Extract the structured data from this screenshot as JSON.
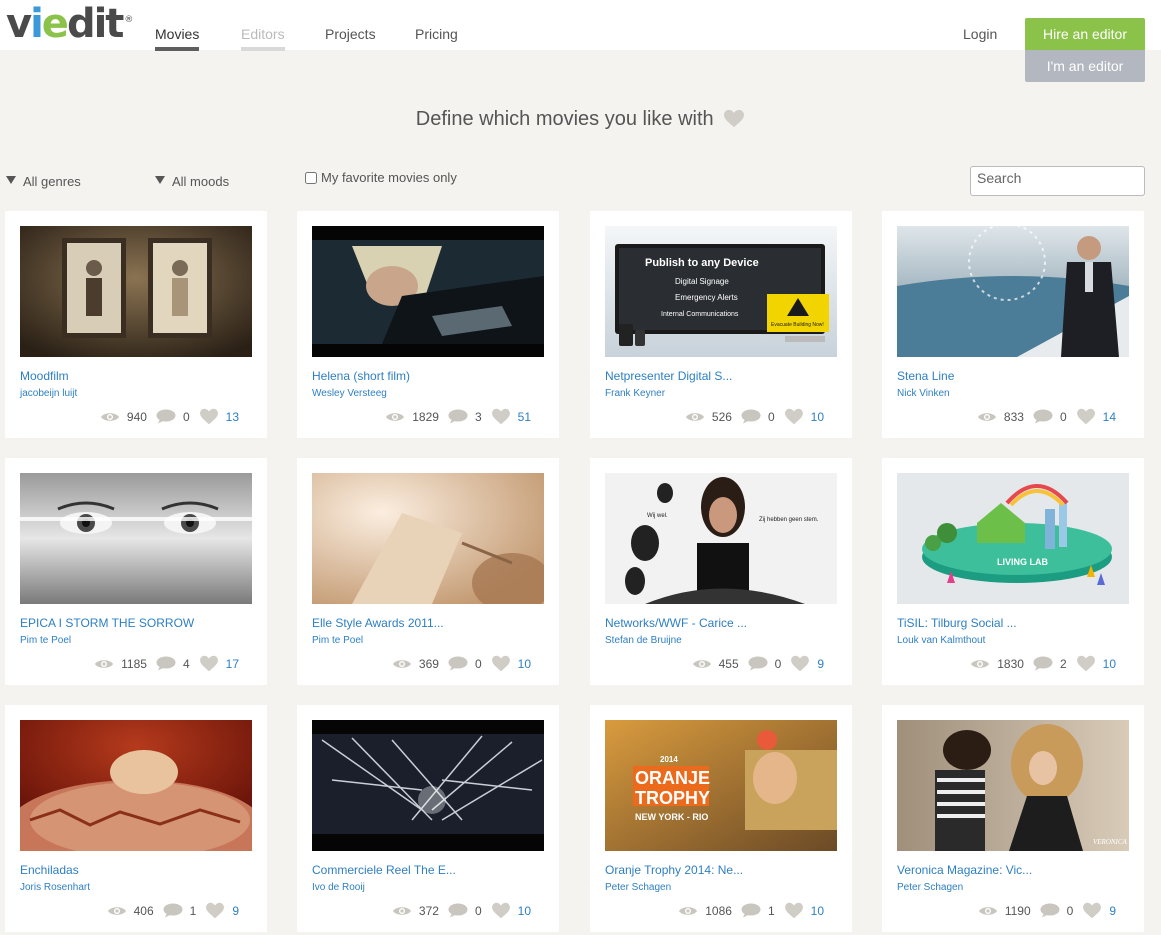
{
  "app": {
    "logo": {
      "v": "v",
      "i": "i",
      "e": "e",
      "dit": "dit",
      "reg": "®"
    }
  },
  "nav": {
    "items": [
      {
        "label": "Movies",
        "state": "active"
      },
      {
        "label": "Editors",
        "state": "muted"
      },
      {
        "label": "Projects",
        "state": "normal"
      },
      {
        "label": "Pricing",
        "state": "normal"
      }
    ],
    "login": "Login",
    "hire_button": "Hire an editor",
    "editor_button": "I'm an editor"
  },
  "colors": {
    "accent_green": "#8bc34a",
    "link_blue": "#2e7fc3",
    "muted_button": "#b3b7bf",
    "heart_grey": "#d0ccc6"
  },
  "headline": {
    "text": "Define which movies you like with",
    "icon": "heart-icon"
  },
  "filters": {
    "genres": "All genres",
    "moods": "All moods",
    "favorites_label": "My favorite movies only",
    "favorites_checked": false,
    "search_placeholder": "Search"
  },
  "movies": [
    {
      "title": "Moodfilm",
      "author": "jacobeijn luijt",
      "views": "940",
      "comments": "0",
      "likes": "13"
    },
    {
      "title": "Helena (short film)",
      "author": "Wesley Versteeg",
      "views": "1829",
      "comments": "3",
      "likes": "51"
    },
    {
      "title": "Netpresenter Digital S...",
      "author": "Frank Keyner",
      "views": "526",
      "comments": "0",
      "likes": "10"
    },
    {
      "title": "Stena Line",
      "author": "Nick Vinken",
      "views": "833",
      "comments": "0",
      "likes": "14"
    },
    {
      "title": "EPICA I STORM THE SORROW",
      "author": "Pim te Poel",
      "views": "1185",
      "comments": "4",
      "likes": "17"
    },
    {
      "title": "Elle Style Awards 2011...",
      "author": "Pim te Poel",
      "views": "369",
      "comments": "0",
      "likes": "10"
    },
    {
      "title": "Networks/WWF - Carice ...",
      "author": "Stefan de Bruijne",
      "views": "455",
      "comments": "0",
      "likes": "9"
    },
    {
      "title": "TiSIL: Tilburg Social ...",
      "author": "Louk van Kalmthout",
      "views": "1830",
      "comments": "2",
      "likes": "10"
    },
    {
      "title": "Enchiladas",
      "author": "Joris Rosenhart",
      "views": "406",
      "comments": "1",
      "likes": "9"
    },
    {
      "title": "Commerciele Reel The E...",
      "author": "Ivo de Rooij",
      "views": "372",
      "comments": "0",
      "likes": "10"
    },
    {
      "title": "Oranje Trophy 2014: Ne...",
      "author": "Peter Schagen",
      "views": "1086",
      "comments": "1",
      "likes": "10"
    },
    {
      "title": "Veronica Magazine: Vic...",
      "author": "Peter Schagen",
      "views": "1190",
      "comments": "0",
      "likes": "9"
    }
  ],
  "thumbnail_text": {
    "netpresenter": {
      "heading": "Publish to any Device",
      "bullets": [
        "Digital Signage",
        "Emergency Alerts",
        "Internal Communications"
      ],
      "warning": "Evacuate Building Now!"
    },
    "carice": {
      "left": "Wij wel.",
      "right": "Zij hebben geen stem."
    },
    "tisil": {
      "sign": "LIVING LAB"
    },
    "oranje": {
      "year": "2014",
      "line1": "ORANJE",
      "line2": "TROPHY",
      "route": "NEW YORK - RIO"
    },
    "veronica": {
      "mark": "VERONICA"
    }
  }
}
